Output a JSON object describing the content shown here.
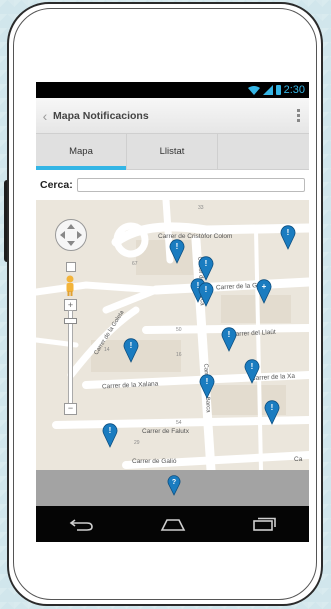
{
  "status": {
    "time": "2:30"
  },
  "actionbar": {
    "title": "Mapa Notificacions"
  },
  "tabs": [
    {
      "label": "Mapa",
      "active": true
    },
    {
      "label": "Llistat",
      "active": false
    }
  ],
  "search": {
    "label": "Cerca:",
    "value": "",
    "placeholder": ""
  },
  "map": {
    "streets": [
      "Carrer de Cristòfor Colom",
      "Carrer de la Goleta",
      "Carrer del Llaüt",
      "Carrer de la Goleta",
      "Carrer de la Xalana",
      "Carrer de la Xa",
      "Carrer de Falutx",
      "Carrer de Galió",
      "Carrer de la Barca",
      "Carrer de la Barca",
      "Ca"
    ],
    "numbers": [
      "67",
      "50",
      "14",
      "16",
      "54",
      "29",
      "33"
    ],
    "pin_count": 13,
    "accent": "#33b5e5",
    "pin_color": "#1a7cc0"
  },
  "bottom_bar": {
    "icon": "question-pin-icon"
  },
  "colors": {
    "accent": "#33b5e5",
    "navbar": "#050505"
  }
}
